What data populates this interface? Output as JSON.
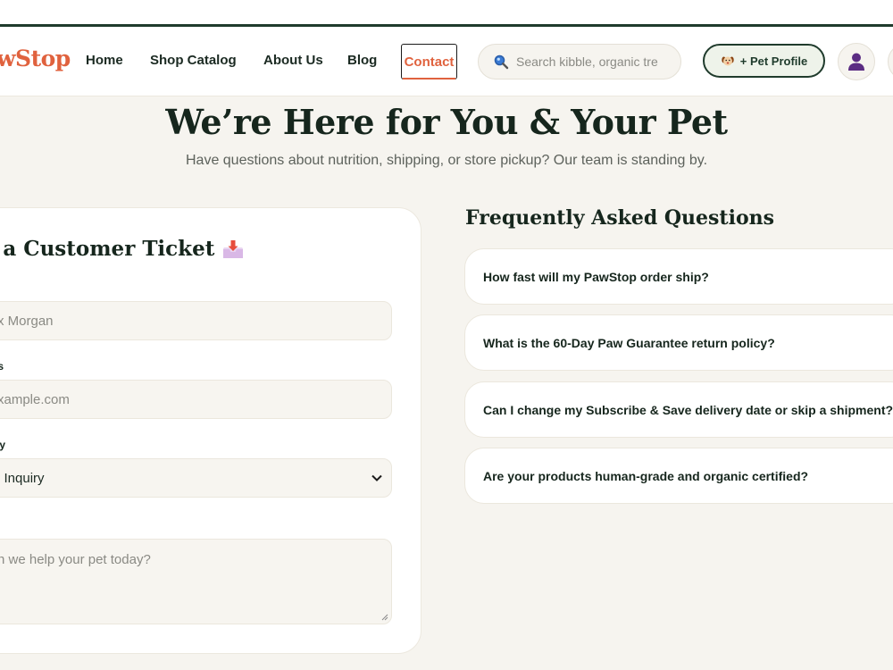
{
  "brand": {
    "logo": "wStop",
    "accent": "#e0623e",
    "dark_green": "#1f3b2c"
  },
  "nav": {
    "items": [
      {
        "label": "Home"
      },
      {
        "label": "Shop Catalog"
      },
      {
        "label": "About Us"
      },
      {
        "label": "Blog"
      }
    ],
    "active": {
      "label": "Contact"
    },
    "search_placeholder": "Search kibble, organic tre",
    "pet_profile_label": "+ Pet Profile",
    "icons": {
      "search": "search-icon",
      "pet": "dog-icon",
      "avatar": "user-icon"
    }
  },
  "hero": {
    "title": "We’re Here for You & Your Pet",
    "subtitle": "Have questions about nutrition, shipping, or store pickup? Our team is standing by."
  },
  "form": {
    "title": "it a Customer Ticket",
    "title_icon": "inbox-tray-icon",
    "name_label": "",
    "name_placeholder": "x Morgan",
    "email_label": "ess",
    "email_placeholder": "xample.com",
    "inquiry_label": "uiry",
    "inquiry_value": "l Inquiry",
    "message_placeholder": "n we help your pet today?"
  },
  "faq": {
    "title": "Frequently Asked Questions",
    "items": [
      {
        "q": "How fast will my PawStop order ship?"
      },
      {
        "q": "What is the 60-Day Paw Guarantee return policy?"
      },
      {
        "q": "Can I change my Subscribe & Save delivery date or skip a shipment?"
      },
      {
        "q": "Are your products human-grade and organic certified?"
      }
    ]
  }
}
